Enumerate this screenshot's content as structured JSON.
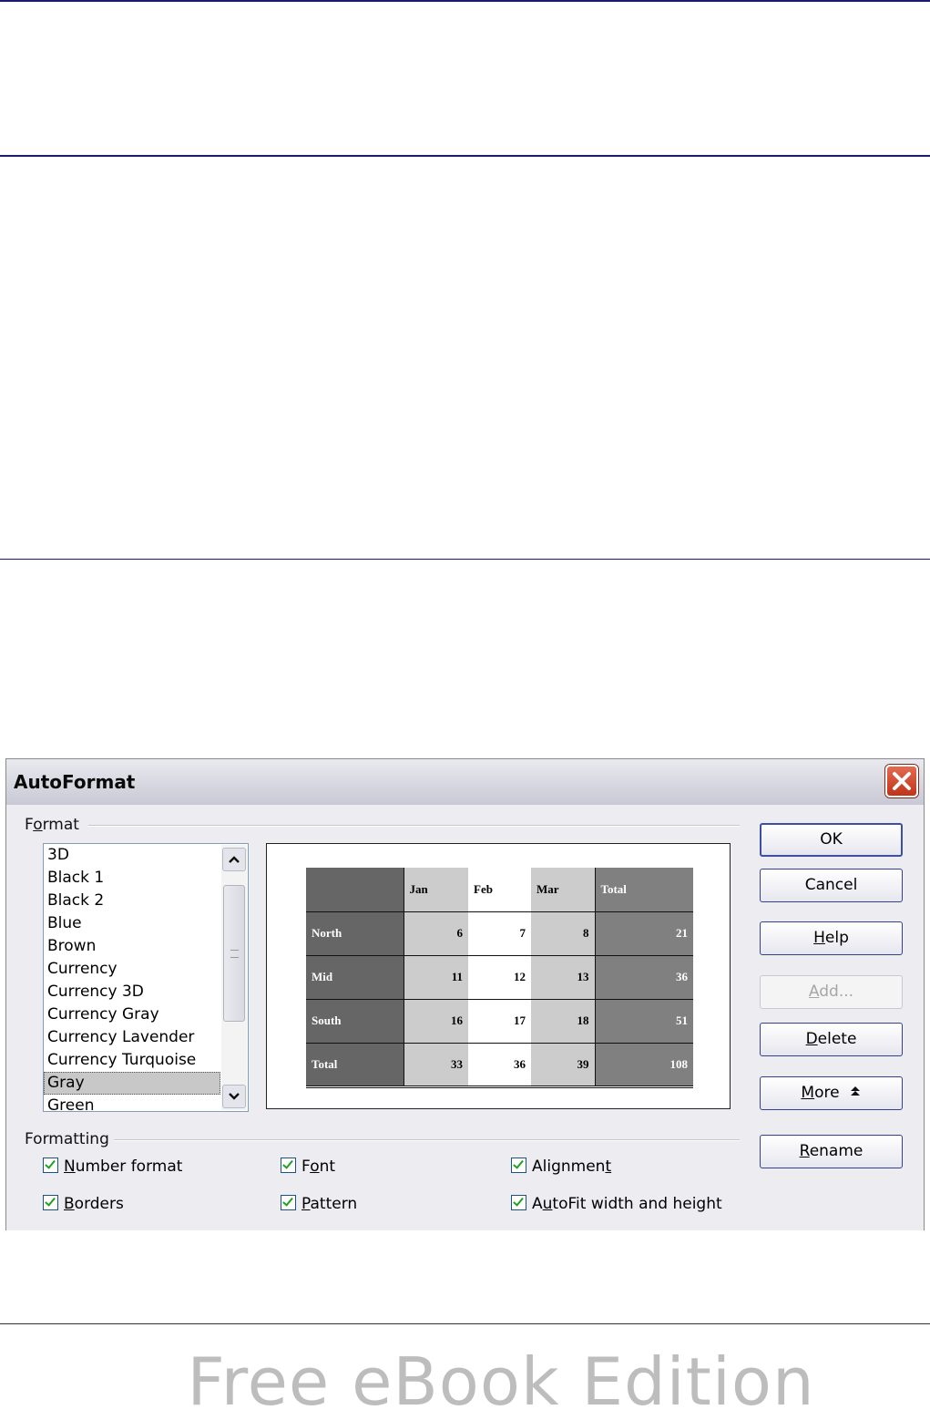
{
  "dialog": {
    "title": "AutoFormat",
    "format_group": {
      "pre": "F",
      "u": "o",
      "post": "rmat"
    },
    "formatting_group": "Formatting",
    "formats": [
      "3D",
      "Black 1",
      "Black 2",
      "Blue",
      "Brown",
      "Currency",
      "Currency 3D",
      "Currency Gray",
      "Currency Lavender",
      "Currency Turquoise",
      "Gray",
      "Green"
    ],
    "selected_format": "Gray",
    "preview": {
      "columns": [
        "",
        "Jan",
        "Feb",
        "Mar",
        "Total"
      ],
      "rows": [
        [
          "North",
          "6",
          "7",
          "8",
          "21"
        ],
        [
          "Mid",
          "11",
          "12",
          "13",
          "36"
        ],
        [
          "South",
          "16",
          "17",
          "18",
          "51"
        ],
        [
          "Total",
          "33",
          "36",
          "39",
          "108"
        ]
      ]
    },
    "buttons": {
      "ok": "OK",
      "cancel": "Cancel",
      "help": {
        "u": "H",
        "post": "elp"
      },
      "add": {
        "u": "A",
        "post": "dd..."
      },
      "delete": {
        "u": "D",
        "post": "elete"
      },
      "more": {
        "u": "M",
        "post": "ore"
      },
      "rename": {
        "u": "R",
        "post": "ename"
      }
    },
    "options": {
      "number_format": {
        "u": "N",
        "post": "umber format",
        "checked": true
      },
      "font": {
        "pre": "F",
        "u": "o",
        "post": "nt",
        "checked": true
      },
      "alignment": {
        "pre": "Alignmen",
        "u": "t",
        "post": "",
        "checked": true
      },
      "borders": {
        "u": "B",
        "post": "orders",
        "checked": true
      },
      "pattern": {
        "u": "P",
        "post": "attern",
        "checked": true
      },
      "autofit": {
        "pre": "A",
        "u": "u",
        "post": "toFit width and height",
        "checked": true
      }
    }
  },
  "footer": {
    "watermark": "Free eBook Edition"
  },
  "colors": {
    "rule": "#1a1a6e",
    "check": "#21a121",
    "close": "#c0331a"
  }
}
